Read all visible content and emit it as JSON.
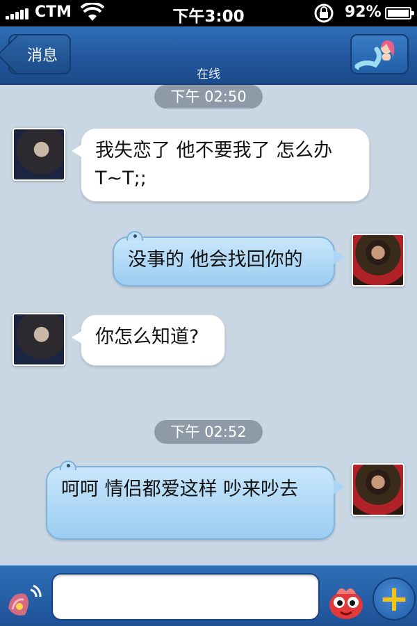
{
  "status_bar": {
    "carrier": "CTM",
    "time": "下午3:00",
    "battery": "92%"
  },
  "nav": {
    "back_label": "消息",
    "status": "在线"
  },
  "messages": {
    "time_1": "下午 02:50",
    "msg_1": "我失恋了 他不要我了 怎么办 T~T;;",
    "msg_2": "没事的 他会找回你的",
    "msg_3": "你怎么知道?",
    "time_2": "下午 02:52",
    "msg_4": "呵呵 情侣都爱这样 吵来吵去"
  },
  "composer": {
    "input_value": "",
    "plus_label": "+"
  },
  "colors": {
    "nav_blue": "#21549a",
    "chat_background": "#c9d6e3",
    "incoming_bubble": "#ffffff",
    "outgoing_bubble": "#9ccdf1",
    "plus_accent": "#f6c417"
  }
}
